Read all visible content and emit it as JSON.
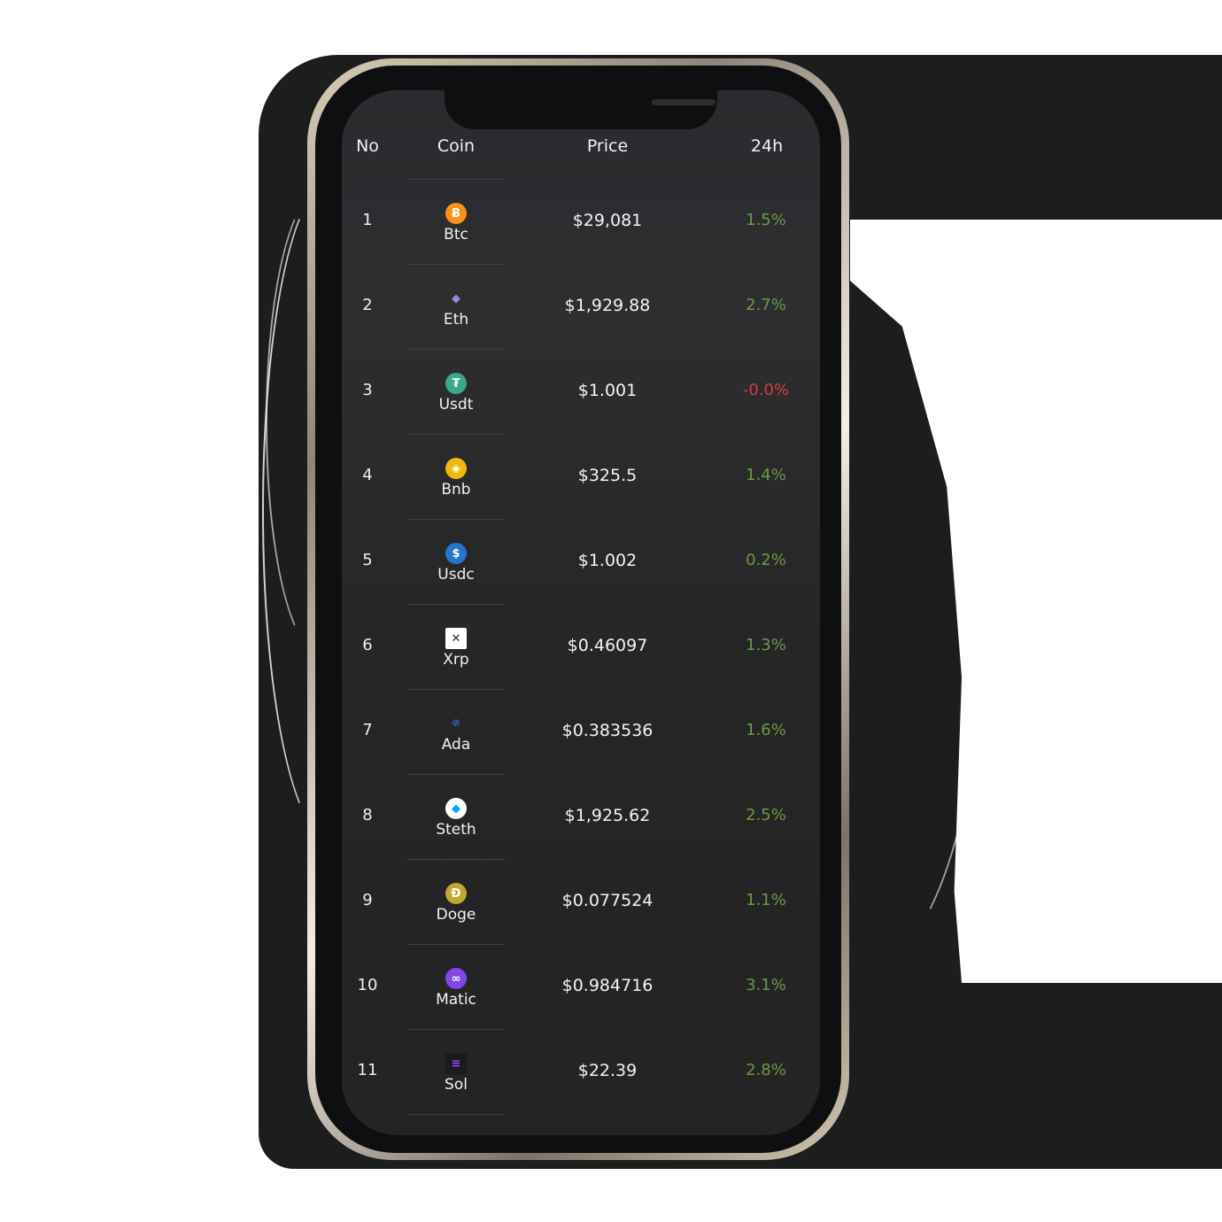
{
  "colors": {
    "positive": "#6a9a46",
    "negative": "#d83a3a",
    "screen_bg": "#2a2b2e",
    "text": "#f2f2f2"
  },
  "table": {
    "headers": {
      "no": "No",
      "coin": "Coin",
      "price": "Price",
      "change": "24h"
    },
    "rows": [
      {
        "no": "1",
        "coin": "Btc",
        "icon": "bitcoin-icon",
        "price": "$29,081",
        "change": "1.5%",
        "direction": "up"
      },
      {
        "no": "2",
        "coin": "Eth",
        "icon": "ethereum-icon",
        "price": "$1,929.88",
        "change": "2.7%",
        "direction": "up"
      },
      {
        "no": "3",
        "coin": "Usdt",
        "icon": "tether-icon",
        "price": "$1.001",
        "change": "-0.0%",
        "direction": "down"
      },
      {
        "no": "4",
        "coin": "Bnb",
        "icon": "bnb-icon",
        "price": "$325.5",
        "change": "1.4%",
        "direction": "up"
      },
      {
        "no": "5",
        "coin": "Usdc",
        "icon": "usdc-icon",
        "price": "$1.002",
        "change": "0.2%",
        "direction": "up"
      },
      {
        "no": "6",
        "coin": "Xrp",
        "icon": "xrp-icon",
        "price": "$0.46097",
        "change": "1.3%",
        "direction": "up"
      },
      {
        "no": "7",
        "coin": "Ada",
        "icon": "cardano-icon",
        "price": "$0.383536",
        "change": "1.6%",
        "direction": "up"
      },
      {
        "no": "8",
        "coin": "Steth",
        "icon": "steth-icon",
        "price": "$1,925.62",
        "change": "2.5%",
        "direction": "up"
      },
      {
        "no": "9",
        "coin": "Doge",
        "icon": "dogecoin-icon",
        "price": "$0.077524",
        "change": "1.1%",
        "direction": "up"
      },
      {
        "no": "10",
        "coin": "Matic",
        "icon": "polygon-icon",
        "price": "$0.984716",
        "change": "3.1%",
        "direction": "up"
      },
      {
        "no": "11",
        "coin": "Sol",
        "icon": "solana-icon",
        "price": "$22.39",
        "change": "2.8%",
        "direction": "up"
      }
    ]
  }
}
